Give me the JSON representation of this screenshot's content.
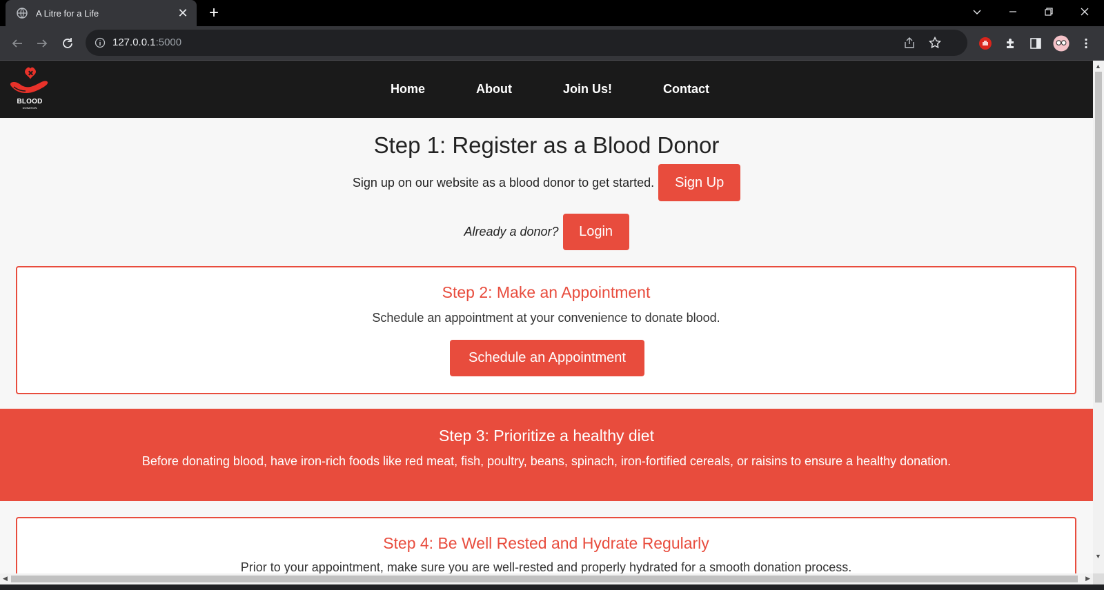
{
  "browser": {
    "tab_title": "A Litre for a Life",
    "new_tab_label": "+",
    "url_host": "127.0.0.1",
    "url_port": ":5000"
  },
  "site": {
    "logo_text": "BLOOD",
    "logo_subtext": "DONATION",
    "nav": [
      {
        "label": "Home"
      },
      {
        "label": "About"
      },
      {
        "label": "Join Us!"
      },
      {
        "label": "Contact"
      }
    ]
  },
  "step1": {
    "title": "Step 1: Register as a Blood Donor",
    "text": "Sign up on our website as a blood donor to get started.",
    "signup_label": "Sign Up",
    "login_prompt": "Already a donor?",
    "login_label": "Login"
  },
  "step2": {
    "title": "Step 2: Make an Appointment",
    "text": "Schedule an appointment at your convenience to donate blood.",
    "button_label": "Schedule an Appointment"
  },
  "step3": {
    "title": "Step 3: Prioritize a healthy diet",
    "text": "Before donating blood, have iron-rich foods like red meat, fish, poultry, beans, spinach, iron-fortified cereals, or raisins to ensure a healthy donation."
  },
  "step4": {
    "title": "Step 4: Be Well Rested and Hydrate Regularly",
    "text": "Prior to your appointment, make sure you are well-rested and properly hydrated for a smooth donation process."
  },
  "colors": {
    "accent": "#e84c3d",
    "header_bg": "#1a1a1a",
    "page_bg": "#f7f7f7"
  }
}
